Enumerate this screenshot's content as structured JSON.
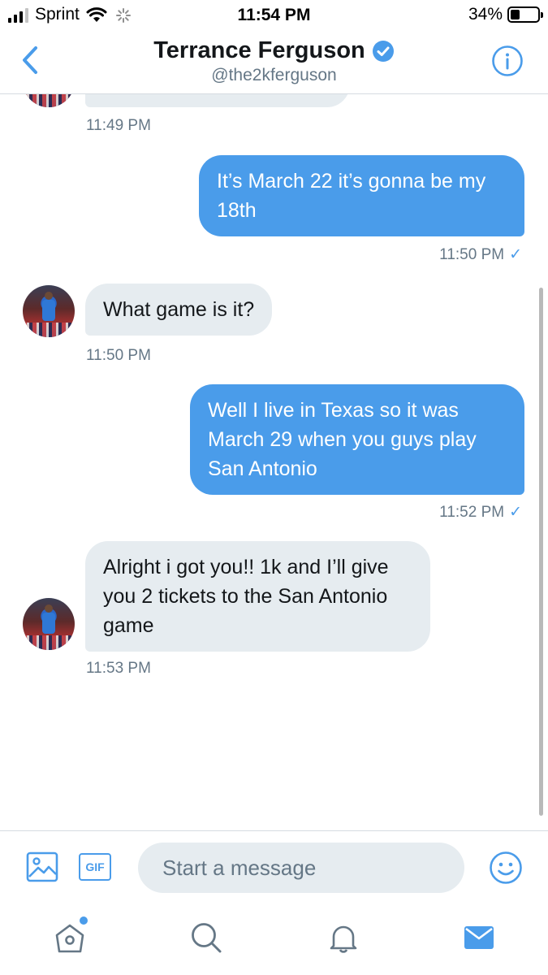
{
  "status_bar": {
    "carrier": "Sprint",
    "time": "11:54 PM",
    "battery_percent": "34%",
    "battery_level": 0.34,
    "signal_bars": 3,
    "signal_bars_total": 4
  },
  "header": {
    "back_icon": "chevron-left-icon",
    "name": "Terrance Ferguson",
    "verified_icon": "verified-badge-icon",
    "handle": "@the2kferguson",
    "info_icon": "info-icon"
  },
  "conversation": {
    "messages": [
      {
        "direction": "incoming",
        "text": "",
        "time": "11:49 PM",
        "partially_visible": true
      },
      {
        "direction": "outgoing",
        "text": "It’s March 22 it’s gonna be my 18th",
        "time": "11:50 PM",
        "read_check": "✓"
      },
      {
        "direction": "incoming",
        "text": "What game is it?",
        "time": "11:50 PM"
      },
      {
        "direction": "outgoing",
        "text": "Well I live in Texas so it was March 29 when you guys play San Antonio",
        "time": "11:52 PM",
        "read_check": "✓"
      },
      {
        "direction": "incoming",
        "text": "Alright i got you!! 1k and I’ll give you 2 tickets to the San Antonio game",
        "time": "11:53 PM"
      }
    ]
  },
  "composer": {
    "image_icon": "image-icon",
    "gif_label": "GIF",
    "placeholder": "Start a message",
    "emoji_icon": "emoji-icon"
  },
  "tabbar": {
    "items": [
      {
        "name": "home",
        "icon": "home-icon",
        "has_notification_dot": true
      },
      {
        "name": "search",
        "icon": "search-icon"
      },
      {
        "name": "notifications",
        "icon": "bell-icon"
      },
      {
        "name": "messages",
        "icon": "mail-icon",
        "active": true
      }
    ]
  },
  "colors": {
    "accent": "#4a9cea",
    "incoming_bubble": "#e6ecf0",
    "secondary_text": "#657786",
    "primary_text": "#14171a"
  }
}
